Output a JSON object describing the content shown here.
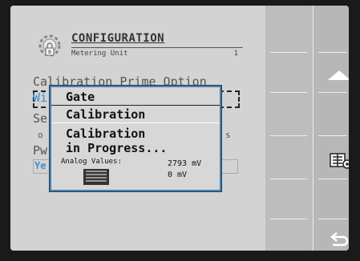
{
  "header": {
    "title": "CONFIGURATION",
    "subtitle": "Metering Unit",
    "page_number": "1"
  },
  "background": {
    "prime_option": "Calibration Prime Option",
    "row_wi": "Wi",
    "row_se": "Se",
    "row_o": "o",
    "row_s": "s",
    "row_pw": "Pw",
    "row_ye": "Ye"
  },
  "popup": {
    "gate": "Gate",
    "calibration": "Calibration",
    "progress_line1": "Calibration",
    "progress_line2": "in Progress...",
    "analog_label": "Analog Values:",
    "value1": "2793 mV",
    "value2": "0 mV"
  },
  "sidebar": {
    "more": "...",
    "icons": [
      "up-arrow-icon",
      "metering-unit-icon",
      "back-icon"
    ]
  }
}
